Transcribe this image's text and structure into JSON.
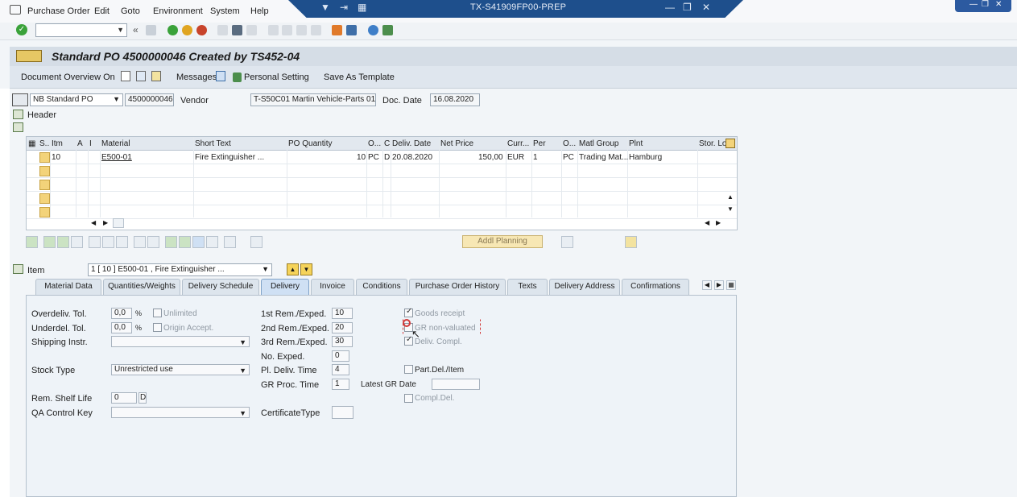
{
  "menubar": {
    "items": [
      "Purchase Order",
      "Edit",
      "Goto",
      "Environment",
      "System",
      "Help"
    ],
    "window_title": "TX-S41909FP00-PREP"
  },
  "page": {
    "title": "Standard PO 4500000046 Created by TS452-04"
  },
  "app_toolbar": {
    "doc_overview": "Document Overview On",
    "messages": "Messages",
    "personal_setting": "Personal Setting",
    "save_template": "Save As Template"
  },
  "header": {
    "po_type": "NB Standard PO",
    "po_number": "4500000046",
    "vendor_label": "Vendor",
    "vendor_value": "T-S50C01 Martin Vehicle-Parts 01",
    "doc_date_label": "Doc. Date",
    "doc_date_value": "16.08.2020",
    "header_label": "Header"
  },
  "grid": {
    "columns": [
      "S..",
      "Itm",
      "A",
      "I",
      "Material",
      "Short Text",
      "PO Quantity",
      "O...",
      "C",
      "Deliv. Date",
      "Net Price",
      "Curr...",
      "Per",
      "O...",
      "Matl Group",
      "Plnt",
      "Stor. Lo"
    ],
    "rows": [
      {
        "itm": "10",
        "material": "E500-01",
        "short_text": "Fire Extinguisher ...",
        "qty": "10",
        "oun": "PC",
        "c": "D",
        "deliv_date": "20.08.2020",
        "net_price": "150,00",
        "curr": "EUR",
        "per": "1",
        "opu": "PC",
        "matl_group": "Trading Mat...",
        "plant": "Hamburg"
      }
    ]
  },
  "addl_planning": "Addl Planning",
  "item": {
    "label": "Item",
    "selected": "1 [ 10 ] E500-01 , Fire Extinguisher ..."
  },
  "tabs": [
    "Material Data",
    "Quantities/Weights",
    "Delivery Schedule",
    "Delivery",
    "Invoice",
    "Conditions",
    "Purchase Order History",
    "Texts",
    "Delivery Address",
    "Confirmations"
  ],
  "delivery": {
    "overdeliv_label": "Overdeliv. Tol.",
    "overdeliv_value": "0,0",
    "pct1": "%",
    "unlimited": "Unlimited",
    "underdel_label": "Underdel. Tol.",
    "underdel_value": "0,0",
    "pct2": "%",
    "origin_accept": "Origin Accept.",
    "shipping_label": "Shipping Instr.",
    "stock_type_label": "Stock Type",
    "stock_type_value": "Unrestricted use",
    "rem_shelf_label": "Rem. Shelf Life",
    "rem_shelf_value": "0",
    "rem_shelf_unit": "D",
    "qa_label": "QA Control Key",
    "rem1_label": "1st Rem./Exped.",
    "rem1_value": "10",
    "rem2_label": "2nd Rem./Exped.",
    "rem2_value": "20",
    "rem3_label": "3rd Rem./Exped.",
    "rem3_value": "30",
    "noexp_label": "No. Exped.",
    "noexp_value": "0",
    "pldeliv_label": "Pl. Deliv. Time",
    "pldeliv_value": "4",
    "grproc_label": "GR Proc. Time",
    "grproc_value": "1",
    "cert_label": "CertificateType",
    "goods_receipt": "Goods receipt",
    "gr_nonvalued": "GR non-valuated",
    "deliv_compl": "Deliv. Compl.",
    "part_del": "Part.Del./Item",
    "latest_gr": "Latest GR Date",
    "compl_del": "Compl.Del."
  }
}
